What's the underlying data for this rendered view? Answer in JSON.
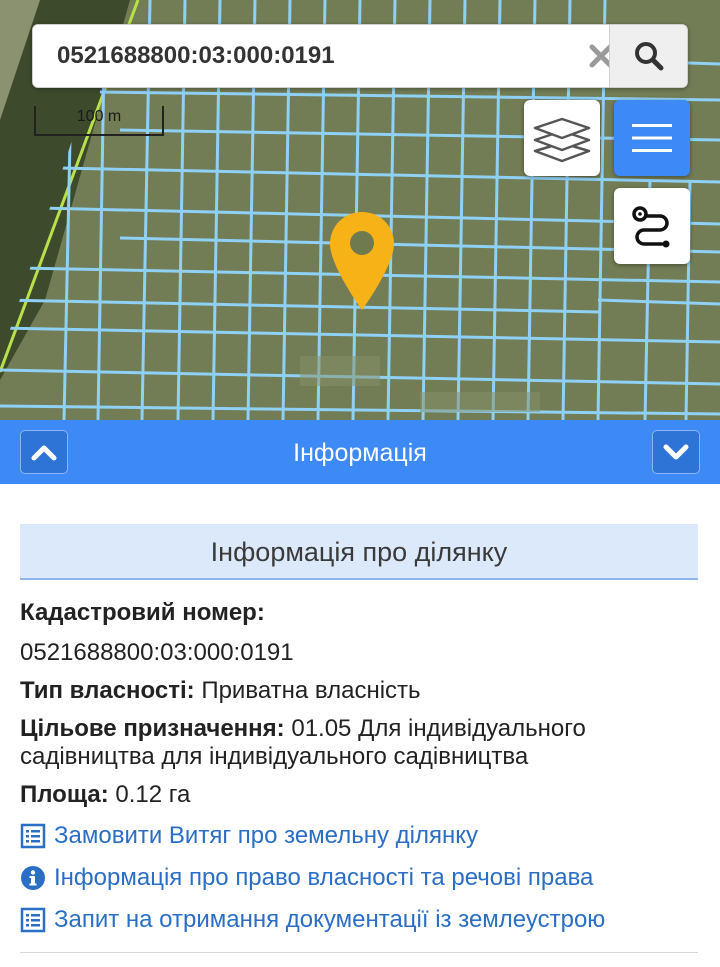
{
  "search": {
    "value": "0521688800:03:000:0191",
    "placeholder": "",
    "clear_icon": "close-icon",
    "search_icon": "search-icon"
  },
  "map": {
    "scale_label": "100 m",
    "layers_icon": "layers-icon",
    "menu_icon": "hamburger-menu-icon",
    "route_icon": "route-icon",
    "marker_icon": "location-pin-icon",
    "colors": {
      "parcel_lines": "#8fd0f5",
      "boundary_line": "#b8e04a",
      "marker": "#f7b217"
    }
  },
  "info_header": {
    "title": "Інформація",
    "collapse_icon": "chevron-up-icon",
    "expand_icon": "chevron-down-icon",
    "color": "#3d8af7"
  },
  "parcel": {
    "section_title": "Інформація про ділянку",
    "cadastral_label": "Кадастровий номер:",
    "cadastral_value": "0521688800:03:000:0191",
    "ownership_label": "Тип власності:",
    "ownership_value": "Приватна власність",
    "purpose_label": "Цільове призначення:",
    "purpose_value_line1": "01.05 Для індивідуального",
    "purpose_value_line2": "садівництва для індивідуального садівництва",
    "area_label": "Площа:",
    "area_value": "0.12 га"
  },
  "links": [
    {
      "label": "Замовити Витяг про земельну ділянку",
      "icon": "list-document-icon"
    },
    {
      "label": "Інформація про право власності та речові права",
      "icon": "info-circle-icon"
    },
    {
      "label": "Запит на отримання документації із землеустрою",
      "icon": "list-document-icon"
    }
  ]
}
